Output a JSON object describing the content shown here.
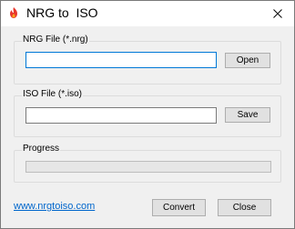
{
  "window": {
    "title": "NRG to  ISO",
    "app_icon": "nrg-to-iso-app-icon",
    "close_icon": "close-icon"
  },
  "nrg_group": {
    "label": "NRG File (*.nrg)",
    "input_value": "",
    "open_label": "Open"
  },
  "iso_group": {
    "label": "ISO File (*.iso)",
    "input_value": "",
    "save_label": "Save"
  },
  "progress_group": {
    "label": "Progress",
    "value": 0
  },
  "footer": {
    "link_text": "www.nrgtoiso.com",
    "convert_label": "Convert",
    "close_label": "Close"
  },
  "colors": {
    "focus_border": "#0078d7",
    "link": "#0066cc",
    "app_icon_red": "#e8362c"
  }
}
